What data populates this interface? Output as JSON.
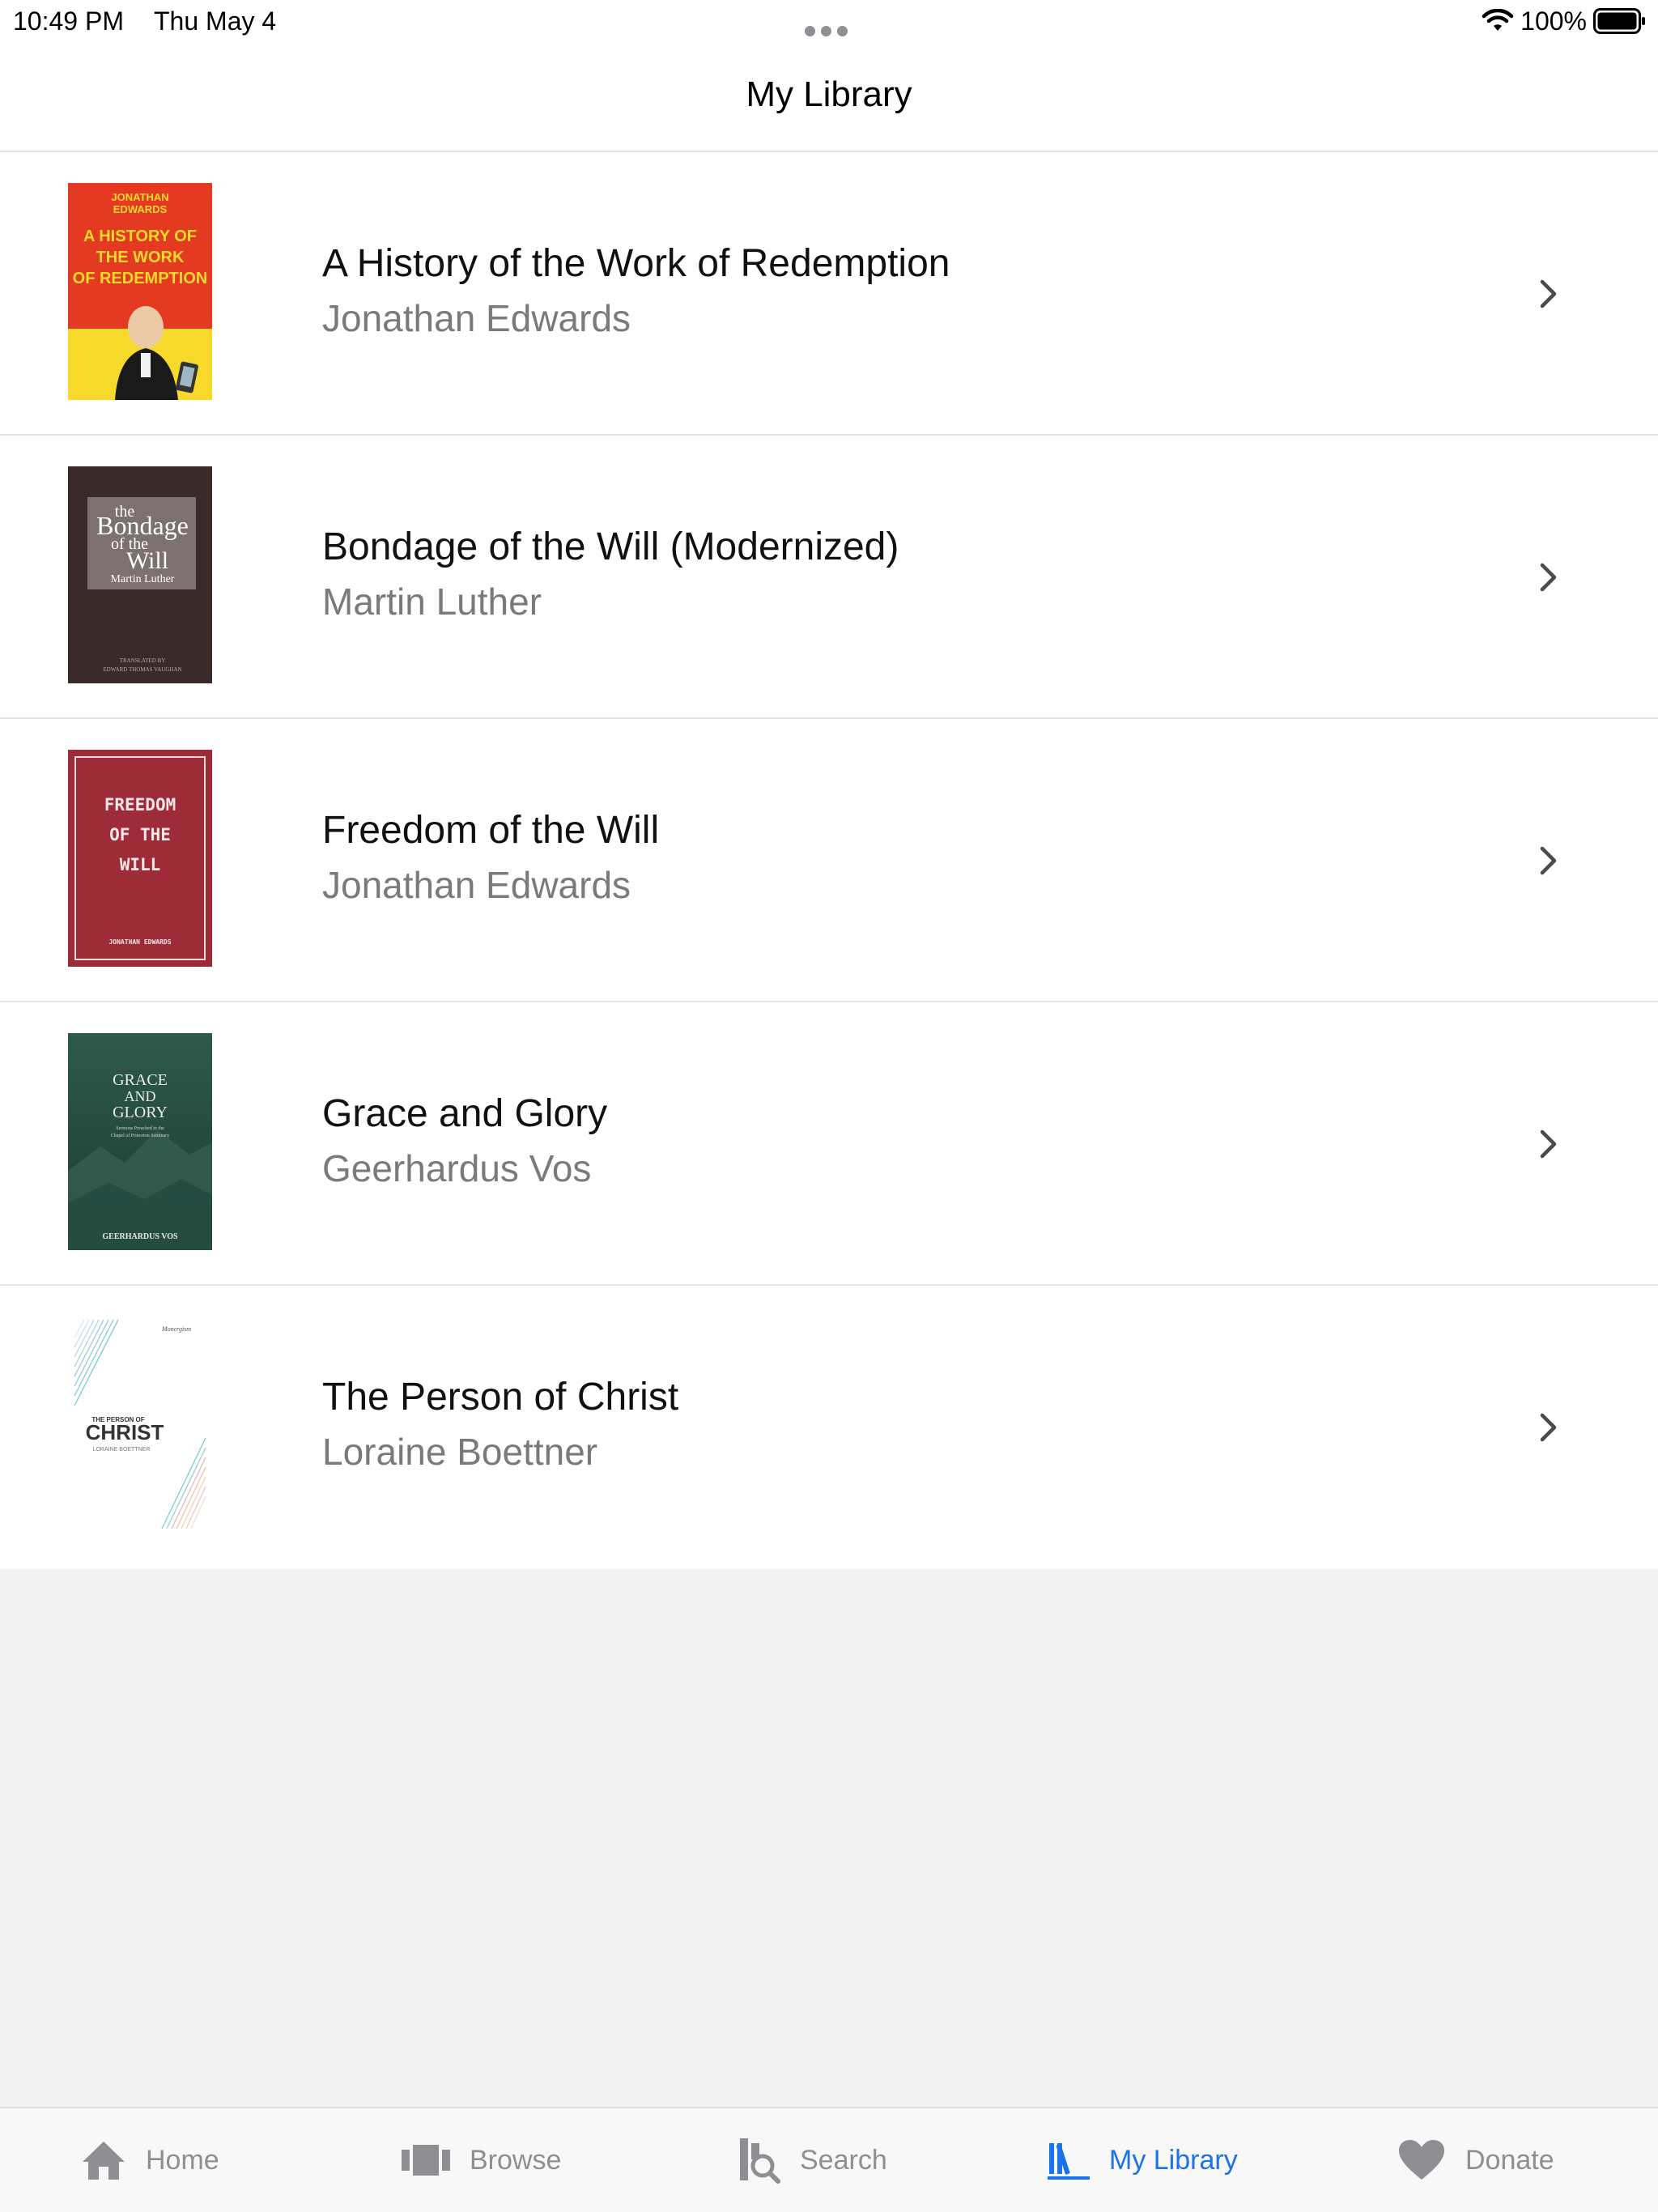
{
  "status_bar": {
    "time": "10:49 PM",
    "date": "Thu May 4",
    "battery": "100%",
    "wifi_icon": "wifi-icon",
    "battery_icon": "battery-icon"
  },
  "nav": {
    "title": "My Library"
  },
  "books": [
    {
      "title": "A History of the Work of Redemption",
      "author": "Jonathan Edwards",
      "cover": {
        "line1": "JONATHAN",
        "line2": "EDWARDS",
        "line3": "A HISTORY OF",
        "line4": "THE WORK",
        "line5": "OF REDEMPTION"
      }
    },
    {
      "title": "Bondage of the Will (Modernized)",
      "author": "Martin Luther",
      "cover": {
        "line1": "the",
        "line2": "Bondage",
        "line3": "of the",
        "line4": "Will",
        "line5": "Martin Luther",
        "line6": "TRANSLATED BY",
        "line7": "EDWARD THOMAS VAUGHAN"
      }
    },
    {
      "title": "Freedom of the Will",
      "author": "Jonathan Edwards",
      "cover": {
        "line1": "FREEDOM",
        "line2": "OF THE",
        "line3": "WILL",
        "line4": "JONATHAN EDWARDS"
      }
    },
    {
      "title": "Grace and Glory",
      "author": "Geerhardus Vos",
      "cover": {
        "line1": "GRACE",
        "line2": "AND",
        "line3": "GLORY",
        "line4": "Sermons Preached in the",
        "line5": "Chapel of Princeton Seminary",
        "line6": "GEERHARDUS VOS"
      }
    },
    {
      "title": "The Person of Christ",
      "author": "Loraine Boettner",
      "cover": {
        "line1": "Monergism",
        "line2": "THE PERSON OF",
        "line3": "CHRIST",
        "line4": "LORAINE BOETTNER"
      }
    }
  ],
  "tabs": [
    {
      "label": "Home",
      "icon": "home-icon",
      "active": false
    },
    {
      "label": "Browse",
      "icon": "browse-icon",
      "active": false
    },
    {
      "label": "Search",
      "icon": "search-icon",
      "active": false
    },
    {
      "label": "My Library",
      "icon": "library-icon",
      "active": true
    },
    {
      "label": "Donate",
      "icon": "heart-icon",
      "active": false
    }
  ],
  "colors": {
    "accent": "#1a73e8",
    "inactive": "#8e8e93",
    "author_text": "#7a7a7a"
  }
}
